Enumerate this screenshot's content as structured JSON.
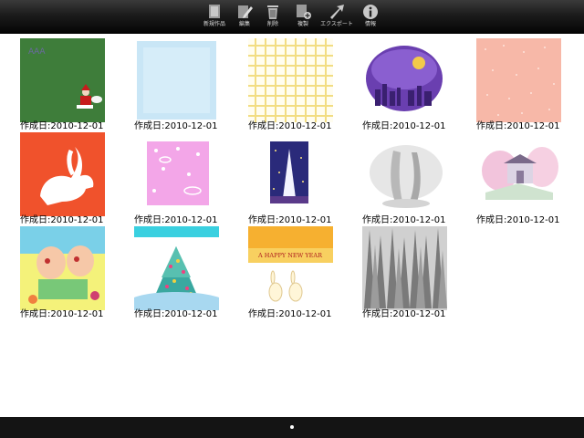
{
  "toolbar": {
    "buttons": [
      {
        "label": "新規作品",
        "icon": "new-document-icon"
      },
      {
        "label": "編集",
        "icon": "pencil-icon"
      },
      {
        "label": "削除",
        "icon": "trash-icon"
      },
      {
        "label": "複製",
        "icon": "duplicate-icon"
      },
      {
        "label": "エクスポート",
        "icon": "export-arrow-icon"
      },
      {
        "label": "情報",
        "icon": "info-icon"
      }
    ]
  },
  "artworks": [
    {
      "date": "作成日:2010-12-01",
      "preview": "green-santa"
    },
    {
      "date": "作成日:2010-12-01",
      "preview": "light-blue-texture"
    },
    {
      "date": "作成日:2010-12-01",
      "preview": "yellow-grid"
    },
    {
      "date": "作成日:2010-12-01",
      "preview": "purple-night-moon"
    },
    {
      "date": "作成日:2010-12-01",
      "preview": "pink-dots"
    },
    {
      "date": "作成日:2010-12-01",
      "preview": "red-rabbit"
    },
    {
      "date": "作成日:2010-12-01",
      "preview": "pink-rabbits"
    },
    {
      "date": "作成日:2010-12-01",
      "preview": "night-tower"
    },
    {
      "date": "作成日:2010-12-01",
      "preview": "gray-waterfall"
    },
    {
      "date": "作成日:2010-12-01",
      "preview": "pink-shrine"
    },
    {
      "date": "作成日:2010-12-01",
      "preview": "colorful-rabbits"
    },
    {
      "date": "作成日:2010-12-01",
      "preview": "christmas-tree"
    },
    {
      "date": "作成日:2010-12-01",
      "preview": "happy-new-year",
      "caption": "A HAPPY NEW YEAR"
    },
    {
      "date": "作成日:2010-12-01",
      "preview": "snowy-forest"
    }
  ],
  "pager": {
    "pages": 1,
    "current": 1
  }
}
